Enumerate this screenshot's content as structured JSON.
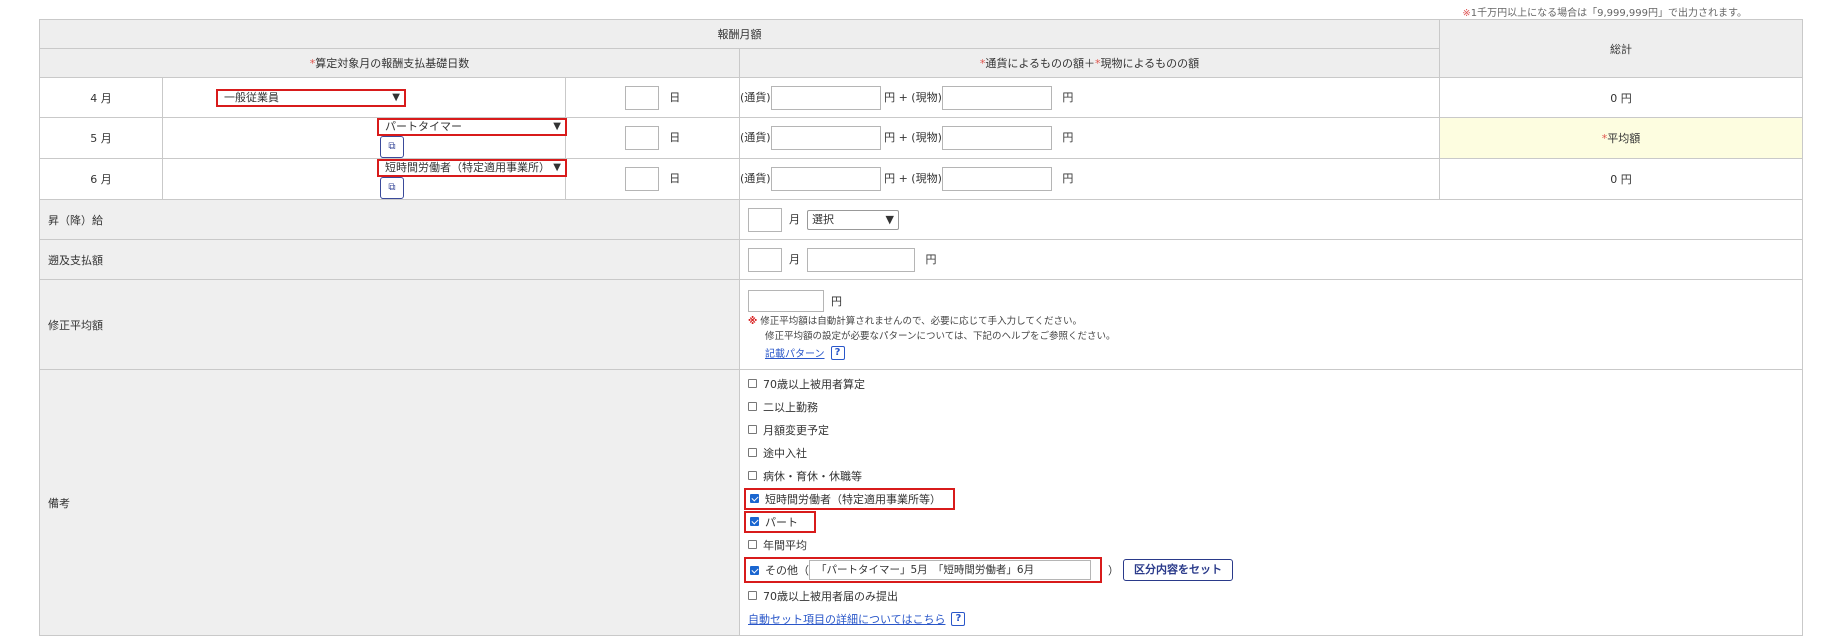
{
  "top_note": {
    "asterisk": "※",
    "text": "1千万円以上になる場合は「9,999,999円」で出力されます。"
  },
  "header": {
    "compensation_month": "報酬月額",
    "total": "総計",
    "basis_days_req": "*",
    "basis_days": "算定対象月の報酬支払基礎日数",
    "currency_req": "*",
    "currency_label": "通貨によるものの額＋",
    "kind_req": "*",
    "kind_label": "現物によるものの額"
  },
  "rows": [
    {
      "month": "4 月",
      "employment": "一般従業員",
      "day_unit": "日",
      "currency_prefix": "(通貨)",
      "yen_plus": "円 + (現物)",
      "yen": "円",
      "total": "0 円",
      "has_copy": false
    },
    {
      "month": "5 月",
      "employment": "パートタイマー",
      "day_unit": "日",
      "currency_prefix": "(通貨)",
      "yen_plus": "円 + (現物)",
      "yen": "円",
      "total_req": "*",
      "total": "平均額",
      "has_copy": true
    },
    {
      "month": "6 月",
      "employment": "短時間労働者（特定適用事業所）",
      "day_unit": "日",
      "currency_prefix": "(通貨)",
      "yen_plus": "円 + (現物)",
      "yen": "円",
      "total": "0 円",
      "has_copy": true
    }
  ],
  "raise": {
    "label": "昇（降）給",
    "month_unit": "月",
    "select_value": "選択"
  },
  "retro": {
    "label": "遡及支払額",
    "month_unit": "月",
    "yen": "円"
  },
  "revised_avg": {
    "label": "修正平均額",
    "yen": "円",
    "warn_mark": "※",
    "note1": "修正平均額は自動計算されませんので、必要に応じて手入力してください。",
    "note2": "修正平均額の設定が必要なパターンについては、下記のヘルプをご参照ください。",
    "link": "記載パターン",
    "help": "?"
  },
  "remarks": {
    "label": "備考",
    "items": [
      {
        "label": "70歳以上被用者算定",
        "checked": false
      },
      {
        "label": "二以上勤務",
        "checked": false
      },
      {
        "label": "月額変更予定",
        "checked": false
      },
      {
        "label": "途中入社",
        "checked": false
      },
      {
        "label": "病休・育休・休職等",
        "checked": false
      },
      {
        "label": "短時間労働者（特定適用事業所等）",
        "checked": true
      },
      {
        "label": "パート",
        "checked": true
      },
      {
        "label": "年間平均",
        "checked": false
      }
    ],
    "other_label": "その他",
    "other_paren_open": "（",
    "other_value": "「パートタイマー」5月　「短時間労働者」6月",
    "other_paren_close": "）",
    "set_button": "区分内容をセット",
    "last_item": "70歳以上被用者届のみ提出",
    "auto_link": "自動セット項目の詳細についてはこちら",
    "help": "?"
  }
}
